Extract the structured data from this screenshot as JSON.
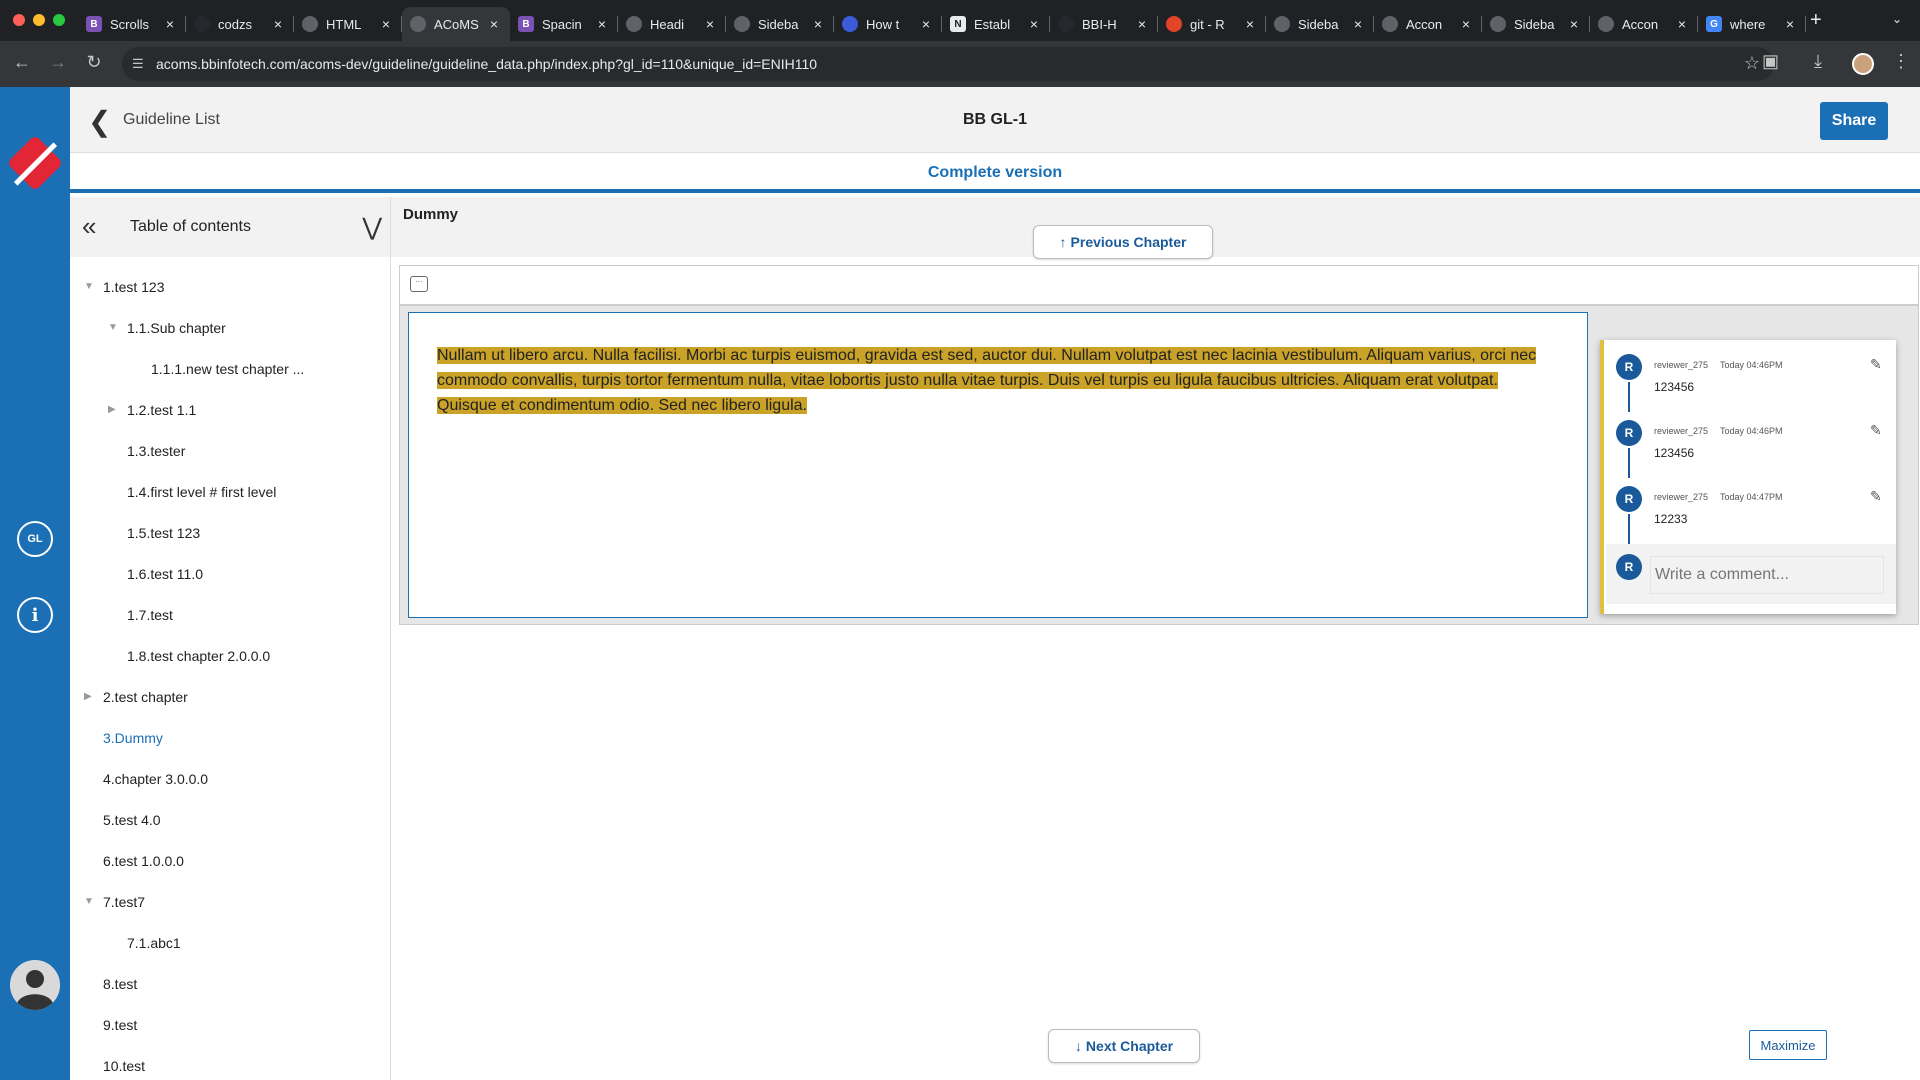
{
  "browser": {
    "tabs": [
      {
        "title": "Scrolls",
        "favicon": "bootstrap",
        "color": "#7952b3",
        "letter": "B"
      },
      {
        "title": "codzs",
        "favicon": "github",
        "color": "#24292f",
        "letter": ""
      },
      {
        "title": "HTML",
        "favicon": "globe",
        "color": "#5f6368",
        "letter": ""
      },
      {
        "title": "ACoMS",
        "favicon": "globe",
        "color": "#5f6368",
        "letter": "",
        "active": true
      },
      {
        "title": "Spacin",
        "favicon": "bootstrap",
        "color": "#7952b3",
        "letter": "B"
      },
      {
        "title": "Headi",
        "favicon": "openai",
        "color": "#5f6368",
        "letter": ""
      },
      {
        "title": "Sideba",
        "favicon": "globe",
        "color": "#5f6368",
        "letter": ""
      },
      {
        "title": "How t",
        "favicon": "browser",
        "color": "#3b5bdb",
        "letter": ""
      },
      {
        "title": "Establ",
        "favicon": "notion",
        "color": "#e8eaed",
        "letter": "N"
      },
      {
        "title": "BBI-H",
        "favicon": "github",
        "color": "#24292f",
        "letter": ""
      },
      {
        "title": "git - R",
        "favicon": "gitlab",
        "color": "#e24329",
        "letter": ""
      },
      {
        "title": "Sideba",
        "favicon": "globe",
        "color": "#5f6368",
        "letter": ""
      },
      {
        "title": "Accon",
        "favicon": "globe",
        "color": "#5f6368",
        "letter": ""
      },
      {
        "title": "Sideba",
        "favicon": "globe",
        "color": "#5f6368",
        "letter": ""
      },
      {
        "title": "Accon",
        "favicon": "globe",
        "color": "#5f6368",
        "letter": ""
      },
      {
        "title": "where",
        "favicon": "google",
        "color": "#4285f4",
        "letter": "G"
      }
    ],
    "url": "acoms.bbinfotech.com/acoms-dev/guideline/guideline_data.php/index.php?gl_id=110&unique_id=ENIH110"
  },
  "header": {
    "back_label": "Guideline List",
    "title": "BB GL-1",
    "share_label": "Share"
  },
  "version_label": "Complete version",
  "toc": {
    "title": "Table of contents",
    "items": [
      {
        "label": "1.test 123",
        "level": 0,
        "caret": "down"
      },
      {
        "label": "1.1.Sub chapter",
        "level": 1,
        "caret": "down"
      },
      {
        "label": "1.1.1.new test chapter ...",
        "level": 2,
        "caret": ""
      },
      {
        "label": "1.2.test 1.1",
        "level": 1,
        "caret": "right"
      },
      {
        "label": "1.3.tester",
        "level": 1,
        "caret": ""
      },
      {
        "label": "1.4.first level # first level",
        "level": 1,
        "caret": ""
      },
      {
        "label": "1.5.test 123",
        "level": 1,
        "caret": ""
      },
      {
        "label": "1.6.test 11.0",
        "level": 1,
        "caret": ""
      },
      {
        "label": "1.7.test",
        "level": 1,
        "caret": ""
      },
      {
        "label": "1.8.test chapter 2.0.0.0",
        "level": 1,
        "caret": ""
      },
      {
        "label": "2.test chapter",
        "level": 0,
        "caret": "right"
      },
      {
        "label": "3.Dummy",
        "level": 0,
        "caret": "",
        "active": true
      },
      {
        "label": "4.chapter 3.0.0.0",
        "level": 0,
        "caret": ""
      },
      {
        "label": "5.test 4.0",
        "level": 0,
        "caret": ""
      },
      {
        "label": "6.test 1.0.0.0",
        "level": 0,
        "caret": ""
      },
      {
        "label": "7.test7",
        "level": 0,
        "caret": "down"
      },
      {
        "label": "7.1.abc1",
        "level": 1,
        "caret": ""
      },
      {
        "label": "8.test",
        "level": 0,
        "caret": ""
      },
      {
        "label": "9.test",
        "level": 0,
        "caret": ""
      },
      {
        "label": "10.test",
        "level": 0,
        "caret": ""
      }
    ]
  },
  "content": {
    "chapter_title": "Dummy",
    "previous_label": "Previous Chapter",
    "next_label": "Next Chapter",
    "body_text": "Nullam ut libero arcu. Nulla facilisi. Morbi ac turpis euismod, gravida est sed, auctor dui. Nullam volutpat est nec lacinia vestibulum. Aliquam varius, orci nec commodo convallis, turpis tortor fermentum nulla, vitae lobortis justo nulla vitae turpis. Duis vel turpis eu ligula faucibus ultricies. Aliquam erat volutpat. Quisque et condimentum odio. Sed nec libero ligula.",
    "highlight_color": "#c9a227",
    "maximize_label": "Maximize"
  },
  "comments": {
    "items": [
      {
        "initial": "R",
        "user": "reviewer_275",
        "time": "Today 04:46PM",
        "text": "123456"
      },
      {
        "initial": "R",
        "user": "reviewer_275",
        "time": "Today 04:46PM",
        "text": "123456"
      },
      {
        "initial": "R",
        "user": "reviewer_275",
        "time": "Today 04:47PM",
        "text": "12233"
      }
    ],
    "compose_initial": "R",
    "compose_placeholder": "Write a comment..."
  },
  "colors": {
    "brand": "#1a6fb5",
    "logo": "#e32636"
  }
}
